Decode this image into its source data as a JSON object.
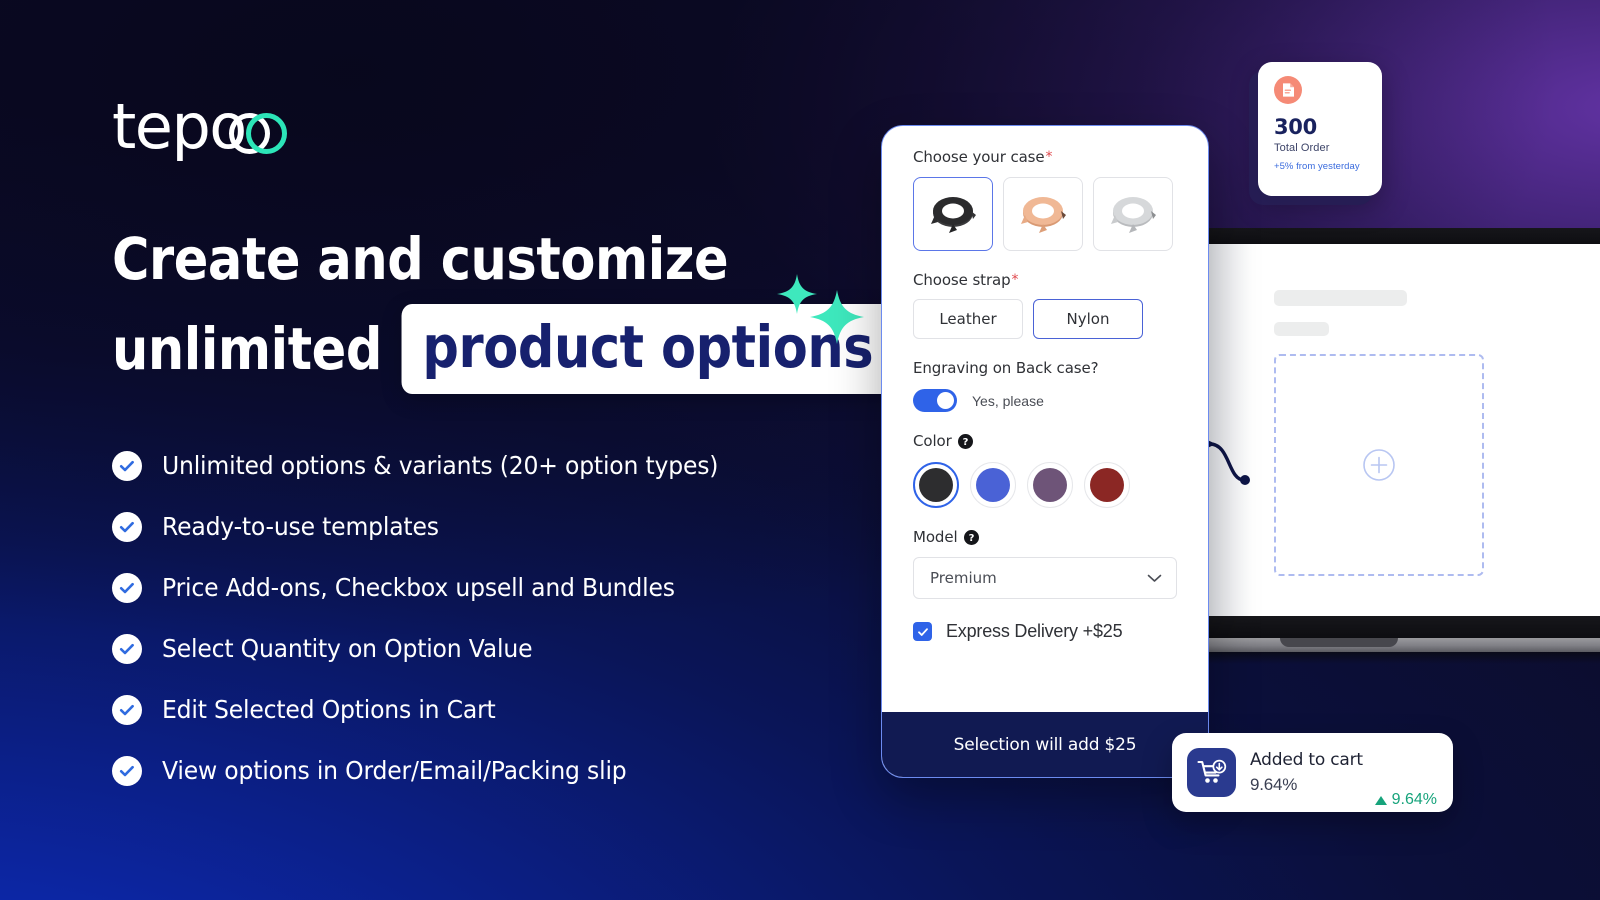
{
  "brand": {
    "logo_text": "tepo",
    "logo_accent_color": "#2ce5b8"
  },
  "headline": {
    "line1": "Create and customize",
    "line2_prefix": "unlimited",
    "line2_badge": "product options"
  },
  "features": [
    {
      "label": "Unlimited options & variants (20+ option types)"
    },
    {
      "label": "Ready-to-use templates"
    },
    {
      "label": "Price Add-ons, Checkbox upsell and Bundles"
    },
    {
      "label": "Select Quantity on Option Value"
    },
    {
      "label": "Edit Selected Options in Cart"
    },
    {
      "label": "View options in Order/Email/Packing slip"
    }
  ],
  "stat_card": {
    "icon": "document-icon",
    "value": "300",
    "label": "Total Order",
    "delta": "+5% from yesterday",
    "icon_color": "#f58a76",
    "delta_color": "#3a6bdd"
  },
  "options_card": {
    "case": {
      "label": "Choose your case",
      "required_mark": "*",
      "items": [
        {
          "name": "black-watch-case",
          "selected": true
        },
        {
          "name": "rose-gold-watch-case",
          "selected": false
        },
        {
          "name": "silver-watch-case",
          "selected": false
        }
      ]
    },
    "strap": {
      "label": "Choose strap",
      "required_mark": "*",
      "options": [
        {
          "label": "Leather",
          "selected": false
        },
        {
          "label": "Nylon",
          "selected": true
        }
      ]
    },
    "engraving": {
      "label": "Engraving on Back case?",
      "toggle_on": true,
      "toggle_label": "Yes, please"
    },
    "color": {
      "label": "Color",
      "help": "?",
      "swatches": [
        {
          "name": "black",
          "hex": "#2d2d2f",
          "selected": true
        },
        {
          "name": "blue",
          "hex": "#4a62d6",
          "selected": false
        },
        {
          "name": "purple",
          "hex": "#6e5478",
          "selected": false
        },
        {
          "name": "dark-red",
          "hex": "#8b2724",
          "selected": false
        }
      ]
    },
    "model": {
      "label": "Model",
      "help": "?",
      "value": "Premium"
    },
    "express": {
      "label": "Express Delivery +$25",
      "checked": true
    },
    "footer": {
      "text": "Selection will add $25"
    }
  },
  "cart_card": {
    "title": "Added to cart",
    "value": "9.64%",
    "delta": "9.64%",
    "delta_color": "#16a37b",
    "icon": "shopping-cart-download-icon"
  }
}
